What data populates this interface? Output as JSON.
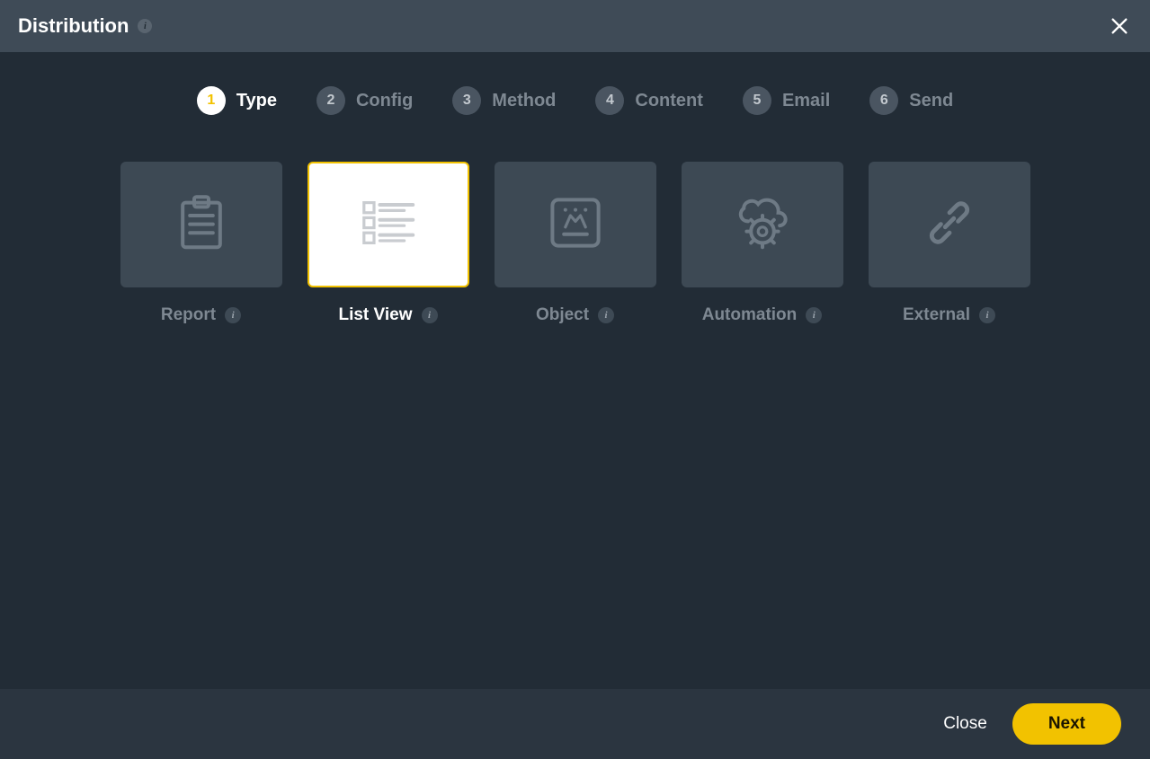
{
  "header": {
    "title": "Distribution"
  },
  "steps": [
    {
      "num": "1",
      "label": "Type"
    },
    {
      "num": "2",
      "label": "Config"
    },
    {
      "num": "3",
      "label": "Method"
    },
    {
      "num": "4",
      "label": "Content"
    },
    {
      "num": "5",
      "label": "Email"
    },
    {
      "num": "6",
      "label": "Send"
    }
  ],
  "active_step": 0,
  "cards": [
    {
      "label": "Report",
      "icon": "report",
      "selected": false
    },
    {
      "label": "List View",
      "icon": "listview",
      "selected": true
    },
    {
      "label": "Object",
      "icon": "object",
      "selected": false
    },
    {
      "label": "Automation",
      "icon": "automation",
      "selected": false
    },
    {
      "label": "External",
      "icon": "external",
      "selected": false
    }
  ],
  "footer": {
    "close": "Close",
    "next": "Next"
  }
}
